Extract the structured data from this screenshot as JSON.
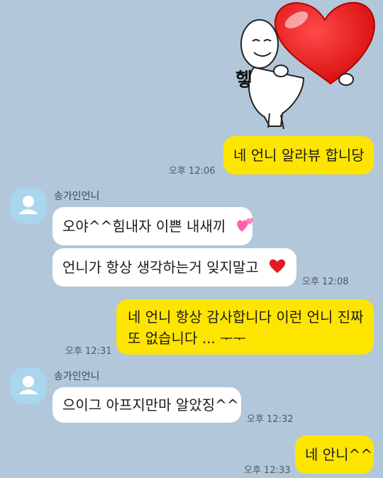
{
  "sticker": {
    "caption": "헿"
  },
  "messages": [
    {
      "id": "m1",
      "side": "me",
      "text": "네 언니 알라뷰 합니당",
      "time": "오후 12:06"
    },
    {
      "id": "m2",
      "side": "other",
      "sender": "송가인언니",
      "text": "오야^^힘내자 이쁜 내새끼",
      "emoji": "two-hearts"
    },
    {
      "id": "m3",
      "side": "other",
      "text": "언니가 항상 생각하는거 잊지말고",
      "emoji": "red-heart",
      "time": "오후 12:08"
    },
    {
      "id": "m4",
      "side": "me",
      "lines": [
        "네 언니 항상 감사합니다 이런 언니 진짜",
        "또 없습니다 ... ᅮᅮ"
      ],
      "time": "오후 12:31"
    },
    {
      "id": "m5",
      "side": "other",
      "sender": "송가인언니",
      "text": "으이그 아프지만마 알았징^^",
      "time": "오후 12:32"
    },
    {
      "id": "m6",
      "side": "me",
      "text": "네 안니^^",
      "time": "오후 12:33"
    }
  ],
  "colors": {
    "background": "#b2c7d9",
    "my_bubble": "#fee500",
    "other_bubble": "#ffffff",
    "avatar": "#a9d6ec"
  }
}
